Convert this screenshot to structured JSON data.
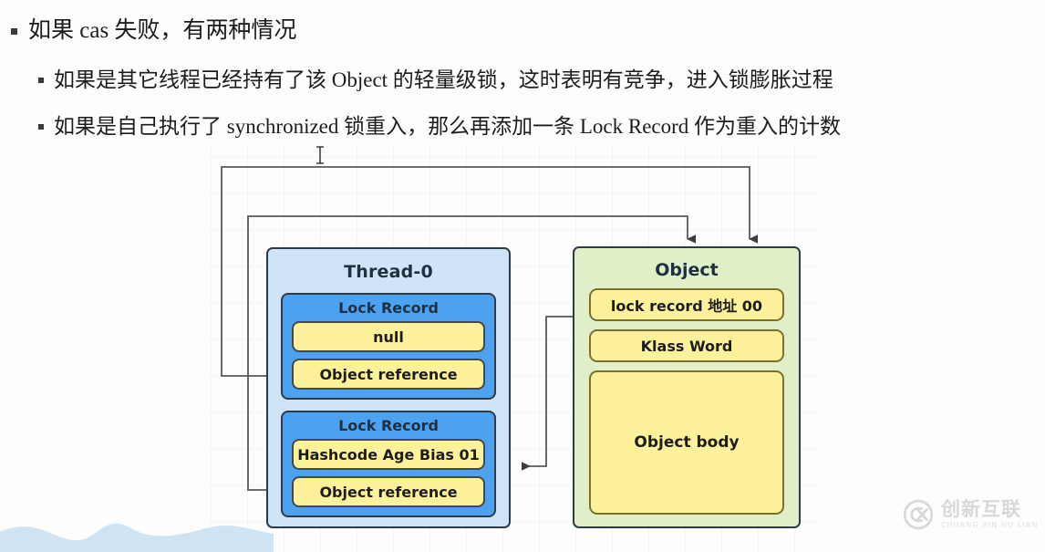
{
  "notes": {
    "items": [
      {
        "level": 1,
        "text": "如果 cas 失败，有两种情况"
      },
      {
        "level": 2,
        "text": "如果是其它线程已经持有了该 Object 的轻量级锁，这时表明有竞争，进入锁膨胀过程"
      },
      {
        "level": 2,
        "text": "如果是自己执行了 synchronized 锁重入，那么再添加一条 Lock Record 作为重入的计数"
      }
    ]
  },
  "diagram": {
    "thread": {
      "title": "Thread-0",
      "lock_records": [
        {
          "title": "Lock Record",
          "slots": [
            "null",
            "Object reference"
          ]
        },
        {
          "title": "Lock Record",
          "slots": [
            "Hashcode Age Bias 01",
            "Object reference"
          ]
        }
      ]
    },
    "object": {
      "title": "Object",
      "mark_word": "lock record 地址 00",
      "klass_word": "Klass Word",
      "body": "Object body"
    },
    "colors": {
      "thread_bg": "#cfe3f9",
      "lock_record_bg": "#4da2f0",
      "slot_bg": "#fdf29b",
      "object_bg": "#e1efc9",
      "border": "#2e3a46",
      "wire": "#4a4a4a"
    }
  },
  "watermark": {
    "cn": "创新互联",
    "en": "CHUANG XIN HU LIAN"
  }
}
